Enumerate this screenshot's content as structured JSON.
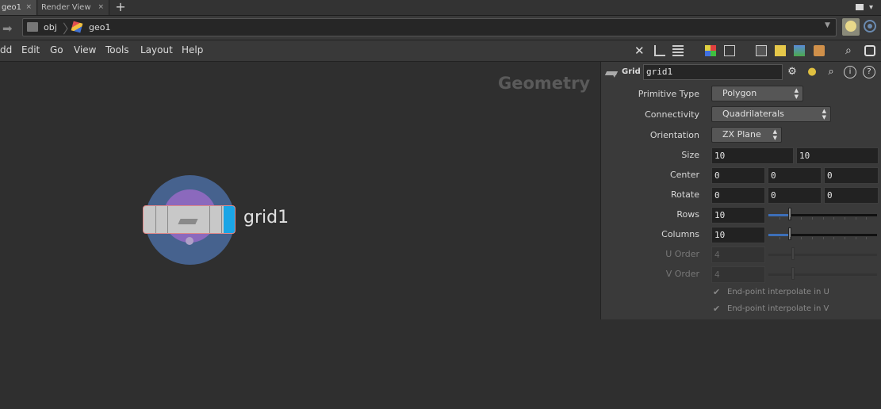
{
  "tabs": [
    {
      "label": "geo1",
      "close": "×"
    },
    {
      "label": "Render View",
      "close": "×"
    }
  ],
  "tab_add": "+",
  "path": {
    "items": [
      "obj",
      "geo1"
    ],
    "dropdown": "▼"
  },
  "menu": [
    "dd",
    "Edit",
    "Go",
    "View",
    "Tools",
    "Layout",
    "Help"
  ],
  "network": {
    "context_label": "Geometry",
    "node": {
      "name": "grid1",
      "flag_color": "#1aa5e6",
      "ring_color": "#46628e",
      "inner_color": "#8b69bd"
    }
  },
  "params": {
    "op_type": "Grid",
    "node_name": "grid1",
    "primitive_type": {
      "label": "Primitive Type",
      "value": "Polygon"
    },
    "connectivity": {
      "label": "Connectivity",
      "value": "Quadrilaterals"
    },
    "orientation": {
      "label": "Orientation",
      "value": "ZX Plane"
    },
    "size": {
      "label": "Size",
      "values": [
        "10",
        "10"
      ]
    },
    "center": {
      "label": "Center",
      "values": [
        "0",
        "0",
        "0"
      ]
    },
    "rotate": {
      "label": "Rotate",
      "values": [
        "0",
        "0",
        "0"
      ]
    },
    "rows": {
      "label": "Rows",
      "value": "10",
      "fraction": 0.2
    },
    "columns": {
      "label": "Columns",
      "value": "10",
      "fraction": 0.2
    },
    "u_order": {
      "label": "U Order",
      "value": "4"
    },
    "v_order": {
      "label": "V Order",
      "value": "4"
    },
    "interp_u": "End-point interpolate in U",
    "interp_v": "End-point interpolate in V"
  },
  "icons": [
    "wrench-icon",
    "tree-icon",
    "list-icon",
    "color-grid-icon",
    "parm-icon",
    "sticky-note-icon",
    "image-icon",
    "network-box-icon",
    "search-icon",
    "eye-icon",
    "gear-icon",
    "python-icon",
    "info-icon",
    "help-icon"
  ],
  "accent": "#1aa5e6"
}
